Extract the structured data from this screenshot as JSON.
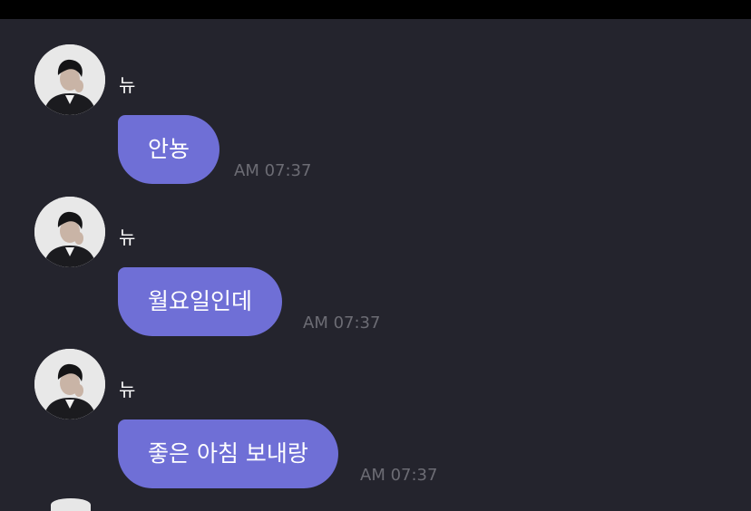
{
  "messages": [
    {
      "sender": "뉴",
      "text": "안뇽",
      "time": "AM 07:37"
    },
    {
      "sender": "뉴",
      "text": "월요일인데",
      "time": "AM 07:37"
    },
    {
      "sender": "뉴",
      "text": "좋은 아침 보내랑",
      "time": "AM 07:37"
    }
  ],
  "colors": {
    "background": "#24242d",
    "bubble": "#6f6fd6",
    "timestamp": "#6c6c74",
    "status_bar": "#000000"
  }
}
